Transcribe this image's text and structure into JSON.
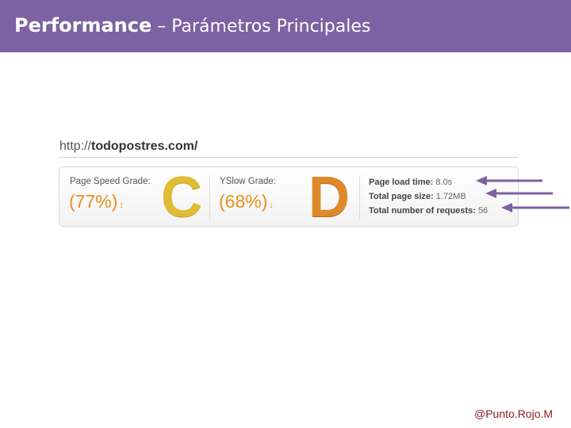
{
  "header": {
    "title_bold": "Performance",
    "title_rest": " – Parámetros Principales",
    "bg_color": "#7c62a3"
  },
  "url": {
    "prefix": "http://",
    "domain": "todopostres.com/"
  },
  "panel": {
    "pagespeed": {
      "label": "Page Speed Grade:",
      "percent": "(77%)",
      "trend_icon": "arrow-icon",
      "grade": "C"
    },
    "yslow": {
      "label": "YSlow Grade:",
      "percent": "(68%)",
      "trend_icon": "down-arrow-icon",
      "grade": "D"
    },
    "metrics": [
      {
        "label": "Page load time:",
        "value": "8.0s"
      },
      {
        "label": "Total page size:",
        "value": "1.72MB"
      },
      {
        "label": "Total number of requests:",
        "value": "56"
      }
    ]
  },
  "annotation_arrow_color": "#7c62a3",
  "footer": {
    "handle": "@Punto.Rojo.M"
  }
}
